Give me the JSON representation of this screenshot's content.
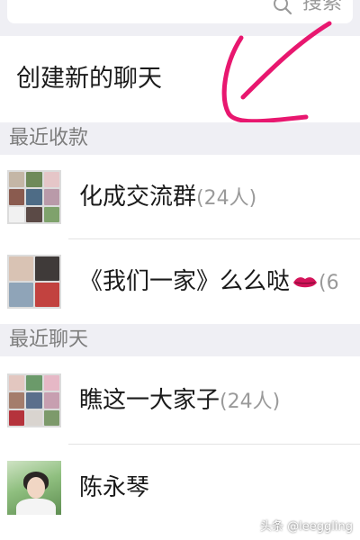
{
  "search": {
    "label": "搜索"
  },
  "create_chat": {
    "label": "创建新的聊天"
  },
  "sections": {
    "recent_collect": {
      "title": "最近收款"
    },
    "recent_chats": {
      "title": "最近聊天"
    }
  },
  "chats": [
    {
      "name": "化成交流群",
      "count": "(24人)"
    },
    {
      "name": "《我们一家》么么哒",
      "count": "(6"
    },
    {
      "name": "瞧这一大家子",
      "count": "(24人)"
    },
    {
      "name": "陈永琴",
      "count": ""
    }
  ],
  "icons": {
    "search": "search-icon",
    "lips": "lips-icon",
    "annotation": "pink-arrow-annotation"
  },
  "colors": {
    "annotation": "#e8176f",
    "section_bg": "#efeff4",
    "muted_text": "#9a9a9a"
  },
  "watermark": {
    "text": "头条 @leeggling"
  }
}
